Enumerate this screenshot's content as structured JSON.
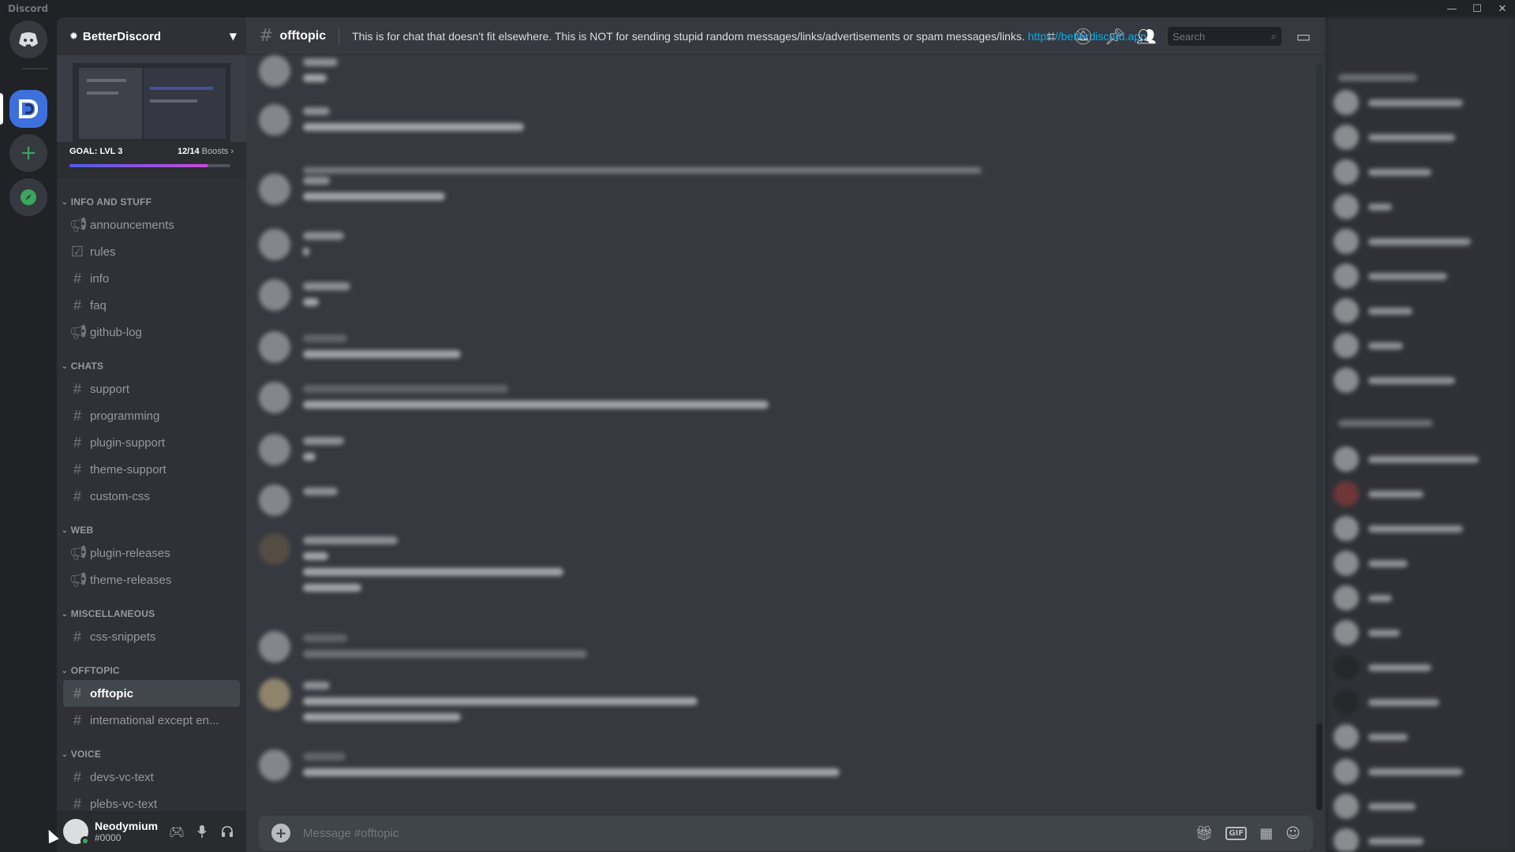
{
  "window": {
    "title": "Discord",
    "controls": [
      "—",
      "☐",
      "✕"
    ]
  },
  "server": {
    "name": "BetterDiscord"
  },
  "boost": {
    "goal": "GOAL: LVL 3",
    "count": "12/14",
    "label": "Boosts",
    "progress": 0.857
  },
  "categories": [
    {
      "name": "INFO AND STUFF",
      "channels": [
        {
          "name": "announcements",
          "icon": "megaphone-icon"
        },
        {
          "name": "rules",
          "icon": "rules-check-icon"
        },
        {
          "name": "info",
          "icon": "hash-icon"
        },
        {
          "name": "faq",
          "icon": "hash-icon"
        },
        {
          "name": "github-log",
          "icon": "megaphone-icon"
        }
      ]
    },
    {
      "name": "CHATS",
      "channels": [
        {
          "name": "support",
          "icon": "hash-icon"
        },
        {
          "name": "programming",
          "icon": "hash-icon"
        },
        {
          "name": "plugin-support",
          "icon": "hash-icon"
        },
        {
          "name": "theme-support",
          "icon": "hash-icon"
        },
        {
          "name": "custom-css",
          "icon": "hash-icon"
        }
      ]
    },
    {
      "name": "WEB",
      "channels": [
        {
          "name": "plugin-releases",
          "icon": "megaphone-icon"
        },
        {
          "name": "theme-releases",
          "icon": "megaphone-icon"
        }
      ]
    },
    {
      "name": "MISCELLANEOUS",
      "channels": [
        {
          "name": "css-snippets",
          "icon": "hash-icon"
        }
      ]
    },
    {
      "name": "OFFTOPIC",
      "channels": [
        {
          "name": "offtopic",
          "icon": "hash-icon",
          "active": true
        },
        {
          "name": "international except en...",
          "icon": "hash-icon"
        }
      ]
    },
    {
      "name": "VOICE",
      "channels": [
        {
          "name": "devs-vc-text",
          "icon": "hash-icon"
        },
        {
          "name": "plebs-vc-text",
          "icon": "hash-icon"
        }
      ]
    }
  ],
  "user": {
    "name": "Neodymium",
    "tag": "#0000",
    "status_color": "#3ba55d"
  },
  "channel": {
    "name": "offtopic",
    "topic": "This is for chat that doesn't fit elsewhere. This is NOT for sending stupid random messages/links/advertisements or spam messages/links.",
    "topic_link": "https://betterdiscord.app/"
  },
  "search": {
    "placeholder": "Search"
  },
  "composer": {
    "placeholder": "Message #offtopic"
  },
  "colors": {
    "accent": "#5865f2",
    "link": "#00aff4",
    "green": "#3ba55d"
  }
}
